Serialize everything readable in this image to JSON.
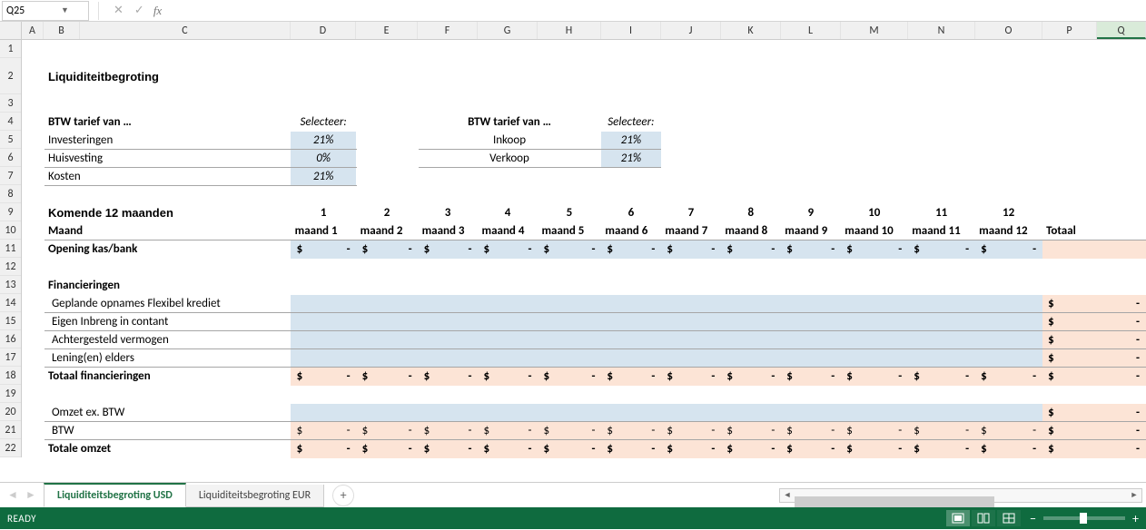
{
  "formula_bar": {
    "name_box": "Q25"
  },
  "columns": [
    "A",
    "B",
    "C",
    "D",
    "E",
    "F",
    "G",
    "H",
    "I",
    "J",
    "K",
    "L",
    "M",
    "N",
    "O",
    "P",
    "Q"
  ],
  "title": "Liquiditeitbegroting",
  "btw1": {
    "header": "BTW tarief van …",
    "select": "Selecteer:",
    "rows": [
      {
        "label": "Investeringen",
        "pct": "21%"
      },
      {
        "label": "Huisvesting",
        "pct": "0%"
      },
      {
        "label": "Kosten",
        "pct": "21%"
      }
    ]
  },
  "btw2": {
    "header": "BTW tarief van …",
    "select": "Selecteer:",
    "rows": [
      {
        "label": "Inkoop",
        "pct": "21%"
      },
      {
        "label": "Verkoop",
        "pct": "21%"
      }
    ]
  },
  "section": "Komende 12 maanden",
  "month_nums": [
    "1",
    "2",
    "3",
    "4",
    "5",
    "6",
    "7",
    "8",
    "9",
    "10",
    "11",
    "12"
  ],
  "maand_label": "Maand",
  "maand_cols": [
    "maand 1",
    "maand 2",
    "maand 3",
    "maand 4",
    "maand 5",
    "maand 6",
    "maand 7",
    "maand 8",
    "maand 9",
    "maand 10",
    "maand 11",
    "maand 12"
  ],
  "totaal": "Totaal",
  "rowlabels": {
    "opening": "Opening kas/bank",
    "fin_header": "Financieringen",
    "fin1": "Geplande opnames Flexibel krediet",
    "fin2": "Eigen Inbreng in contant",
    "fin3": "Achtergesteld vermogen",
    "fin4": "Lening(en) elders",
    "fin_total": "Totaal financieringen",
    "omzet_ex": "Omzet ex. BTW",
    "btw": "BTW",
    "totale_omzet": "Totale omzet"
  },
  "money": {
    "cur": "$",
    "dash": "-"
  },
  "tabs": {
    "active": "Liquiditeitsbegroting USD",
    "inactive": "Liquiditeitsbegroting EUR"
  },
  "status": "READY"
}
